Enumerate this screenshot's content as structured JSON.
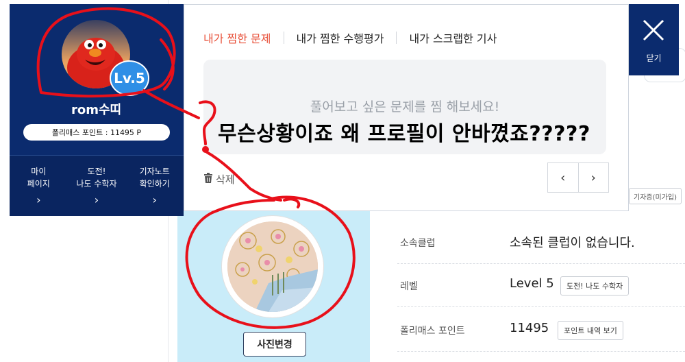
{
  "background": {
    "top_fragment": "",
    "reporter_chip": "기자증(미가입)",
    "photo_change_button": "사진변경",
    "info_rows": [
      {
        "label": "소속클럽",
        "value": "소속된 클럽이 없습니다.",
        "action": ""
      },
      {
        "label": "레벨",
        "value": "Level 5",
        "action": "도전! 나도 수학자"
      },
      {
        "label": "폴리매스 포인트",
        "value": "11495",
        "action": "포인트 내역 보기"
      }
    ]
  },
  "profile": {
    "level_badge": "Lv.5",
    "nickname": "rom수띠",
    "points": "폴리매스 포인트 : 11495 P",
    "nav": [
      {
        "line1": "마이",
        "line2": "페이지",
        "chevron": "›"
      },
      {
        "line1": "도전!",
        "line2": "나도 수학자",
        "chevron": "›"
      },
      {
        "line1": "기자노트",
        "line2": "확인하기",
        "chevron": "›"
      }
    ]
  },
  "popup": {
    "tabs": [
      {
        "label": "내가 찜한 문제",
        "active": true
      },
      {
        "label": "내가 찜한 수행평가",
        "active": false
      },
      {
        "label": "내가 스크랩한 기사",
        "active": false
      }
    ],
    "empty_message": "풀어보고 싶은 문제를 찜 해보세요!",
    "delete_label": "삭제",
    "pager_prev": "‹",
    "pager_next": "›"
  },
  "close_button": {
    "label": "닫기"
  },
  "overlay_text": "무슨상황이죠 왜 프로필이 안바꼈죠?????",
  "colors": {
    "navy": "#0b2b6e",
    "active_tab": "#e8513a",
    "annotation_red": "#e8101a",
    "light_blue": "#c9ecf9"
  },
  "icons": {
    "close": "close-x-icon",
    "delete": "trash-icon",
    "chevron": "chevron-right-icon"
  }
}
